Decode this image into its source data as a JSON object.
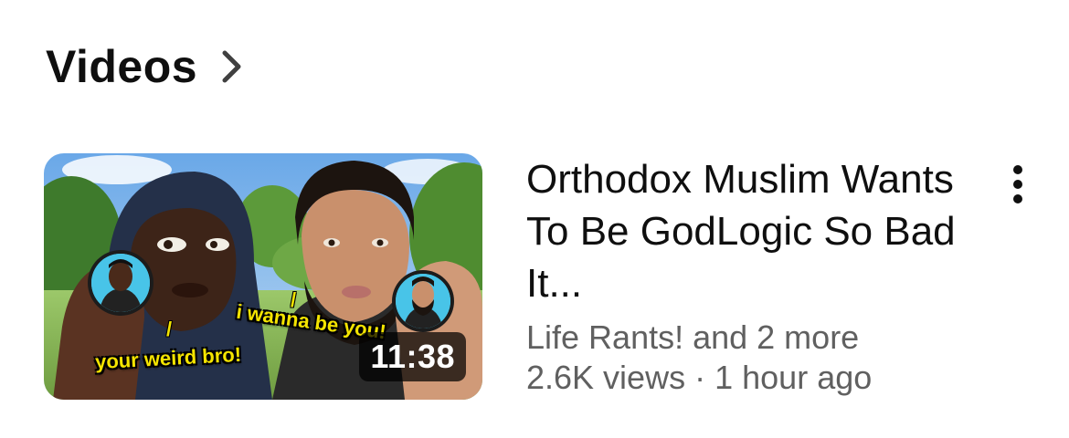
{
  "section": {
    "title": "Videos",
    "chevron_icon": "chevron-right-icon"
  },
  "video": {
    "thumbnail": {
      "caption_left": "your weird bro!",
      "caption_right": "i wanna be you!",
      "slash_mark": "/",
      "duration": "11:38"
    },
    "title": "Orthodox Muslim Wants To Be GodLogic So Bad It...",
    "channel": "Life Rants! and 2 more",
    "views": "2.6K views",
    "separator": "·",
    "time_ago": "1 hour ago",
    "more_icon": "more-vertical-icon"
  }
}
